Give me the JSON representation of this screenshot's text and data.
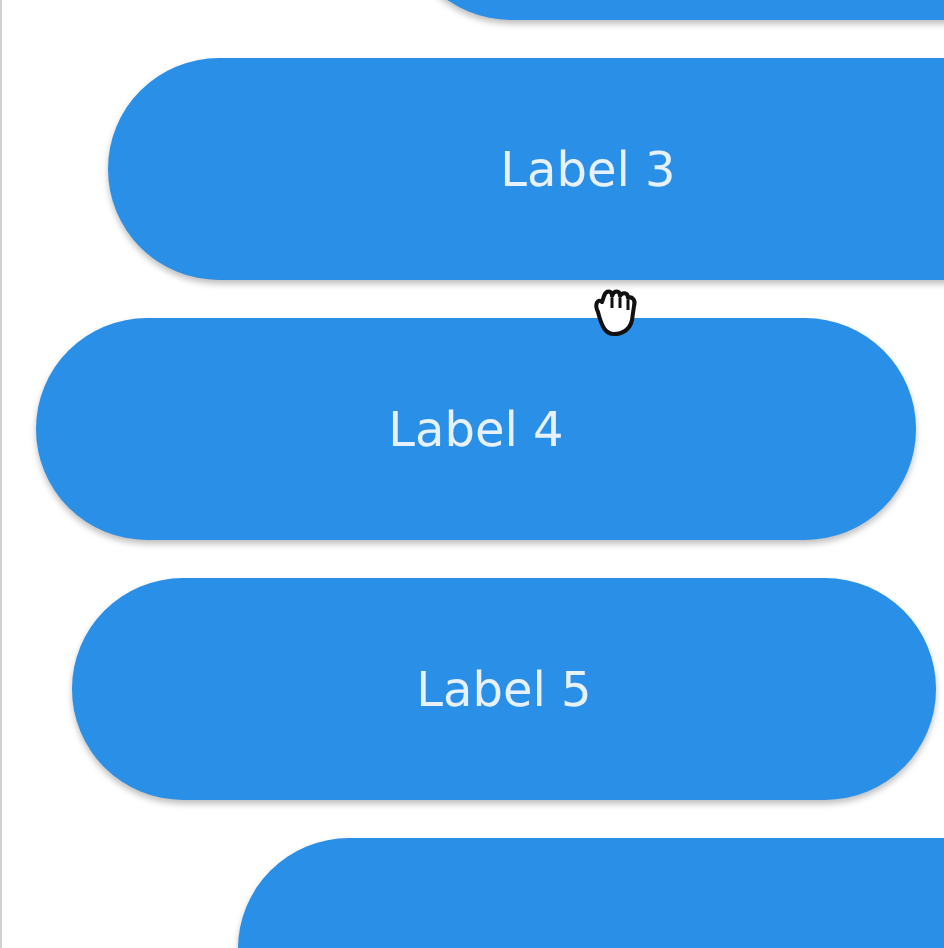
{
  "buttons": [
    {
      "label": "Label 3"
    },
    {
      "label": "Label 4"
    },
    {
      "label": "Label 5"
    }
  ]
}
